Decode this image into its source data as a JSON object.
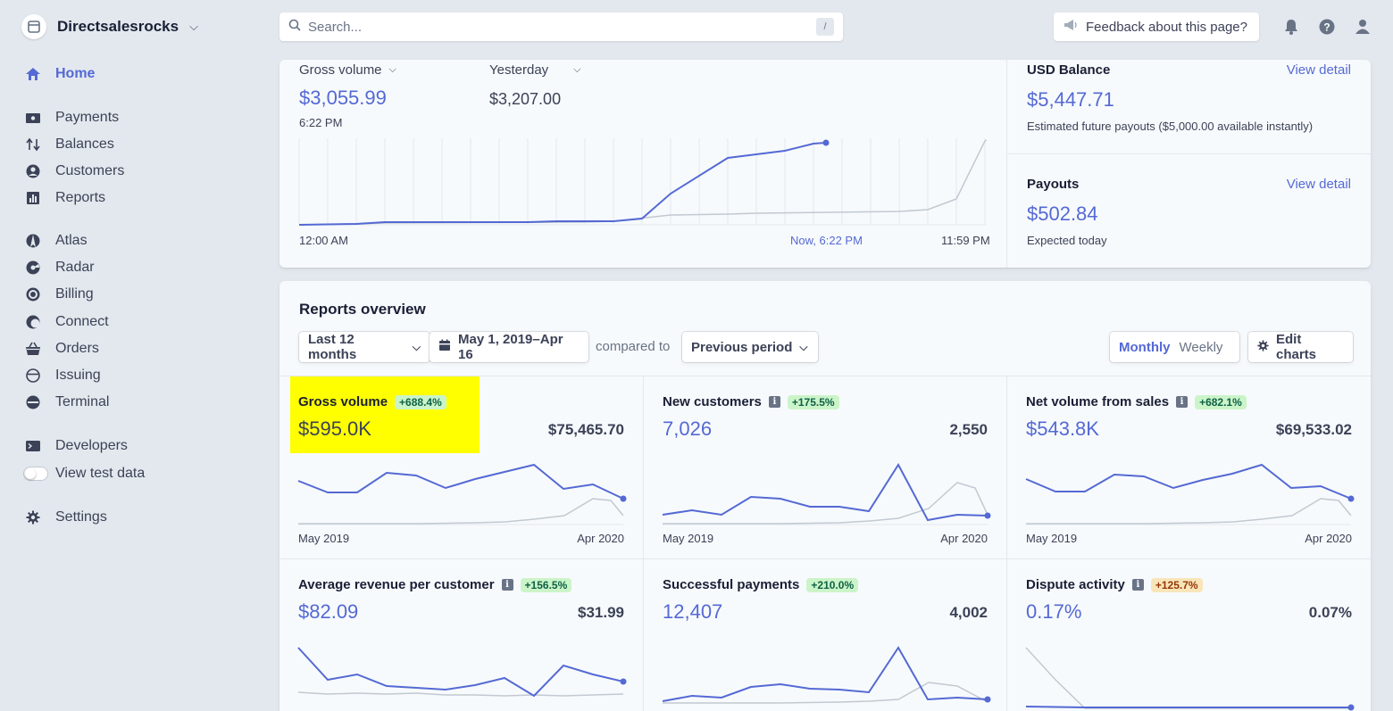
{
  "brand": {
    "name": "Directsalesrocks"
  },
  "nav": {
    "items": [
      {
        "label": "Home",
        "icon": "home-icon",
        "active": true
      },
      {
        "label": "Payments",
        "icon": "payments-icon"
      },
      {
        "label": "Balances",
        "icon": "balances-icon"
      },
      {
        "label": "Customers",
        "icon": "customers-icon"
      },
      {
        "label": "Reports",
        "icon": "reports-icon"
      },
      {
        "label": "Atlas",
        "icon": "atlas-icon"
      },
      {
        "label": "Radar",
        "icon": "radar-icon"
      },
      {
        "label": "Billing",
        "icon": "billing-icon"
      },
      {
        "label": "Connect",
        "icon": "connect-icon"
      },
      {
        "label": "Orders",
        "icon": "orders-icon"
      },
      {
        "label": "Issuing",
        "icon": "issuing-icon"
      },
      {
        "label": "Terminal",
        "icon": "terminal-icon"
      },
      {
        "label": "Developers",
        "icon": "developers-icon"
      },
      {
        "label": "View test data",
        "icon": "toggle-switch"
      },
      {
        "label": "Settings",
        "icon": "gear-icon"
      }
    ]
  },
  "search": {
    "placeholder": "Search...",
    "shortcut": "/"
  },
  "feedback": {
    "label": "Feedback about this page?"
  },
  "today": {
    "metric_label": "Gross volume",
    "compare_label": "Yesterday",
    "value": "$3,055.99",
    "time": "6:22 PM",
    "compare_value": "$3,207.00",
    "x_start": "12:00 AM",
    "x_now": "Now, 6:22 PM",
    "x_end": "11:59 PM"
  },
  "balance": {
    "title": "USD Balance",
    "link": "View detail",
    "value": "$5,447.71",
    "note": "Estimated future payouts ($5,000.00 available instantly)"
  },
  "payouts": {
    "title": "Payouts",
    "link": "View detail",
    "value": "$502.84",
    "note": "Expected today"
  },
  "reports": {
    "title": "Reports overview",
    "range_select": "Last 12 months",
    "date_range": "May 1, 2019–Apr 16",
    "compared_to": "compared to",
    "compare_select": "Previous period",
    "interval_monthly": "Monthly",
    "interval_weekly": "Weekly",
    "edit_charts": "Edit charts",
    "metrics": [
      {
        "title": "Gross volume",
        "info": false,
        "change": "+688.4%",
        "value": "$595.0K",
        "previous": "$75,465.70",
        "x_start": "May 2019",
        "x_end": "Apr 2020",
        "highlighted": true
      },
      {
        "title": "New customers",
        "info": true,
        "change": "+175.5%",
        "value": "7,026",
        "previous": "2,550",
        "x_start": "May 2019",
        "x_end": "Apr 2020"
      },
      {
        "title": "Net volume from sales",
        "info": true,
        "change": "+682.1%",
        "value": "$543.8K",
        "previous": "$69,533.02",
        "x_start": "May 2019",
        "x_end": "Apr 2020"
      },
      {
        "title": "Average revenue per customer",
        "info": true,
        "change": "+156.5%",
        "value": "$82.09",
        "previous": "$31.99"
      },
      {
        "title": "Successful payments",
        "info": false,
        "change": "+210.0%",
        "value": "12,407",
        "previous": "4,002"
      },
      {
        "title": "Dispute activity",
        "info": true,
        "change": "+125.7%",
        "change_tone": "warning",
        "value": "0.17%",
        "previous": "0.07%"
      }
    ]
  },
  "colors": {
    "accent": "#5469d4",
    "background": "#e3e8ee",
    "comparison_line": "#c1c9d2",
    "highlight": "#ffff00"
  }
}
